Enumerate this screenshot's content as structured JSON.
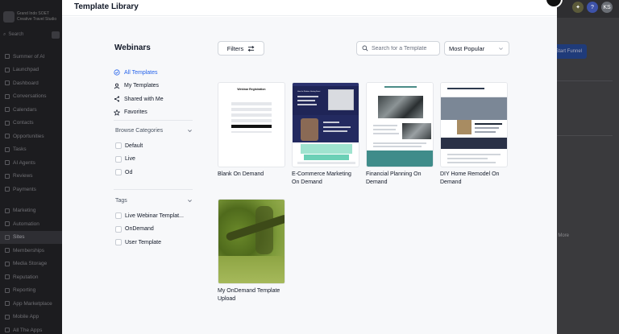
{
  "background_app": {
    "account": {
      "name": "Grand Indo SOET",
      "subtitle": "Creative Travel Studio"
    },
    "search_placeholder": "Search",
    "nav_items": [
      "Summer of AI",
      "Launchpad",
      "Dashboard",
      "Conversations",
      "Calendars",
      "Contacts",
      "Opportunities",
      "Tasks",
      "AI Agents",
      "Reviews",
      "Payments"
    ],
    "nav_items_2": [
      "Marketing",
      "Automation",
      "Sites",
      "Memberships",
      "Media Storage",
      "Reputation",
      "Reporting",
      "App Marketplace",
      "Mobile App",
      "All The Apps"
    ],
    "active_nav": "Sites",
    "create_button": "Start Funnel",
    "more_label": "More",
    "user_initials": "KS",
    "help_icon_label": "?"
  },
  "modal": {
    "title": "Template Library"
  },
  "sidebar": {
    "title": "Webinars",
    "menu": [
      {
        "label": "All Templates",
        "icon": "check-circle-icon",
        "active": true
      },
      {
        "label": "My Templates",
        "icon": "user-icon",
        "active": false
      },
      {
        "label": "Shared with Me",
        "icon": "share-icon",
        "active": false
      },
      {
        "label": "Favorites",
        "icon": "star-icon",
        "active": false
      }
    ],
    "categories": {
      "heading": "Browse Categories",
      "items": [
        "Default",
        "Live",
        "Od"
      ]
    },
    "tags": {
      "heading": "Tags",
      "items": [
        "Live Webinar Templat...",
        "OnDemand",
        "User Template"
      ]
    }
  },
  "toolbar": {
    "filters_label": "Filters",
    "search_placeholder": "Search for a Template",
    "sort_value": "Most Popular"
  },
  "thumbnails": {
    "blank_heading": "Webinar Registration",
    "ecommerce_heading": "How the Webinar Hosting Event"
  },
  "templates": [
    {
      "name": "Blank On Demand"
    },
    {
      "name": "E-Commerce Marketing On Demand"
    },
    {
      "name": "Financial Planning On Demand"
    },
    {
      "name": "DIY Home Remodel On Demand"
    },
    {
      "name": "My OnDemand Template Upload"
    }
  ],
  "colors": {
    "accent": "#2563eb",
    "overlay": "#2b2b2e",
    "modal_bg": "#f7f8fa"
  }
}
